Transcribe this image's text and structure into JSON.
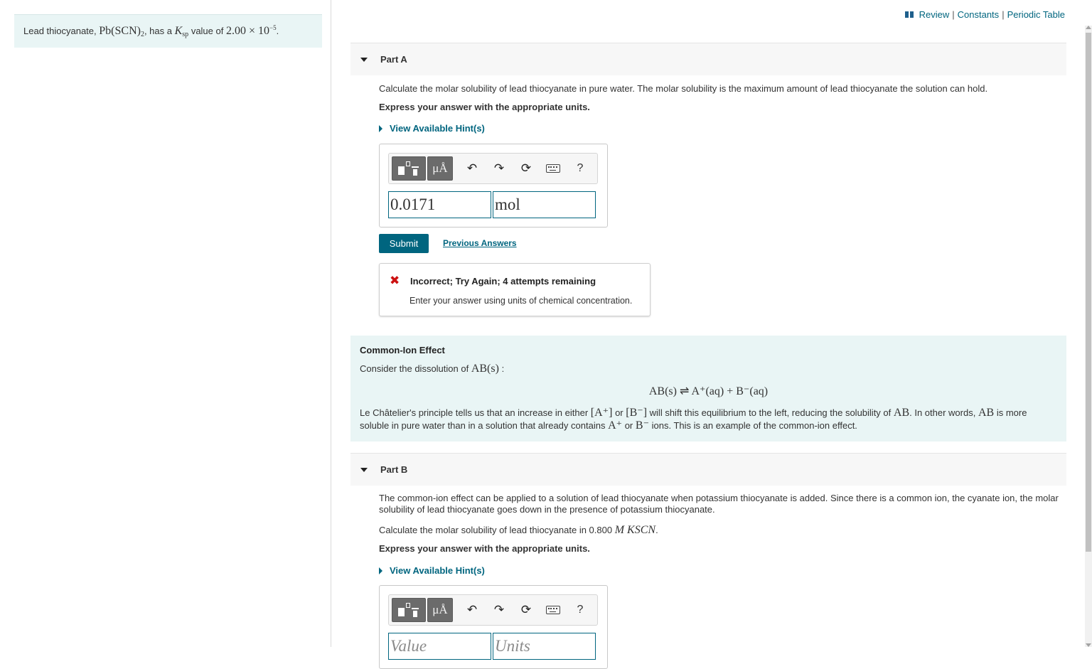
{
  "top_links": {
    "review": "Review",
    "constants": "Constants",
    "periodic_table": "Periodic Table"
  },
  "intro": {
    "prefix": "Lead thiocyanate,",
    "formula_main": "Pb(SCN)",
    "formula_sub": "2",
    "middle": ", has a",
    "k_main": "K",
    "k_sub": "sp",
    "value_label": "value of",
    "value": "2.00 × 10",
    "exponent": "−5",
    "end": "."
  },
  "part_a": {
    "title": "Part A",
    "question": "Calculate the molar solubility of lead thiocyanate in pure water. The molar solubility is the maximum amount of lead thiocyanate the solution can hold.",
    "instruction": "Express your answer with the appropriate units.",
    "hint": "View Available Hint(s)",
    "value_field": "0.0171",
    "units_field": "mol",
    "submit": "Submit",
    "previous_answers": "Previous Answers",
    "feedback_icon": "✖",
    "feedback_title": "Incorrect; Try Again; 4 attempts remaining",
    "feedback_message": "Enter your answer using units of chemical concentration."
  },
  "toolbar": {
    "units_button": "μÅ",
    "undo": "↶",
    "redo": "↷",
    "reset": "⟳",
    "help": "?"
  },
  "common_ion": {
    "title": "Common-Ion Effect",
    "intro": "Consider the dissolution of",
    "intro_math": "AB(s)",
    "intro_colon": ":",
    "equation": "AB(s) ⇌ A⁺(aq) + B⁻(aq)",
    "para_1": "Le Châtelier's principle tells us that an increase in either",
    "conc_a": "[A⁺]",
    "or_1": "or",
    "conc_b": "[B⁻]",
    "para_2": "will shift this equilibrium to the left, reducing the solubility of",
    "ab_1": "AB",
    "para_3": ". In other words,",
    "ab_2": "AB",
    "para_4": "is more soluble in pure water than in a solution that already contains",
    "ion_a": "A⁺",
    "or_2": "or",
    "ion_b": "B⁻",
    "para_5": "ions. This is an example of the common-ion effect."
  },
  "part_b": {
    "title": "Part B",
    "paragraph": "The common-ion effect can be applied to a solution of lead thiocyanate when potassium thiocyanate is added. Since there is a common ion, the cyanate ion, the molar solubility of lead thiocyanate goes down in the presence of potassium thiocyanate.",
    "question_prefix": "Calculate the molar solubility of lead thiocyanate in 0.800",
    "question_math": "M KSCN",
    "question_end": ".",
    "instruction": "Express your answer with the appropriate units.",
    "hint": "View Available Hint(s)",
    "value_placeholder": "Value",
    "units_placeholder": "Units"
  }
}
